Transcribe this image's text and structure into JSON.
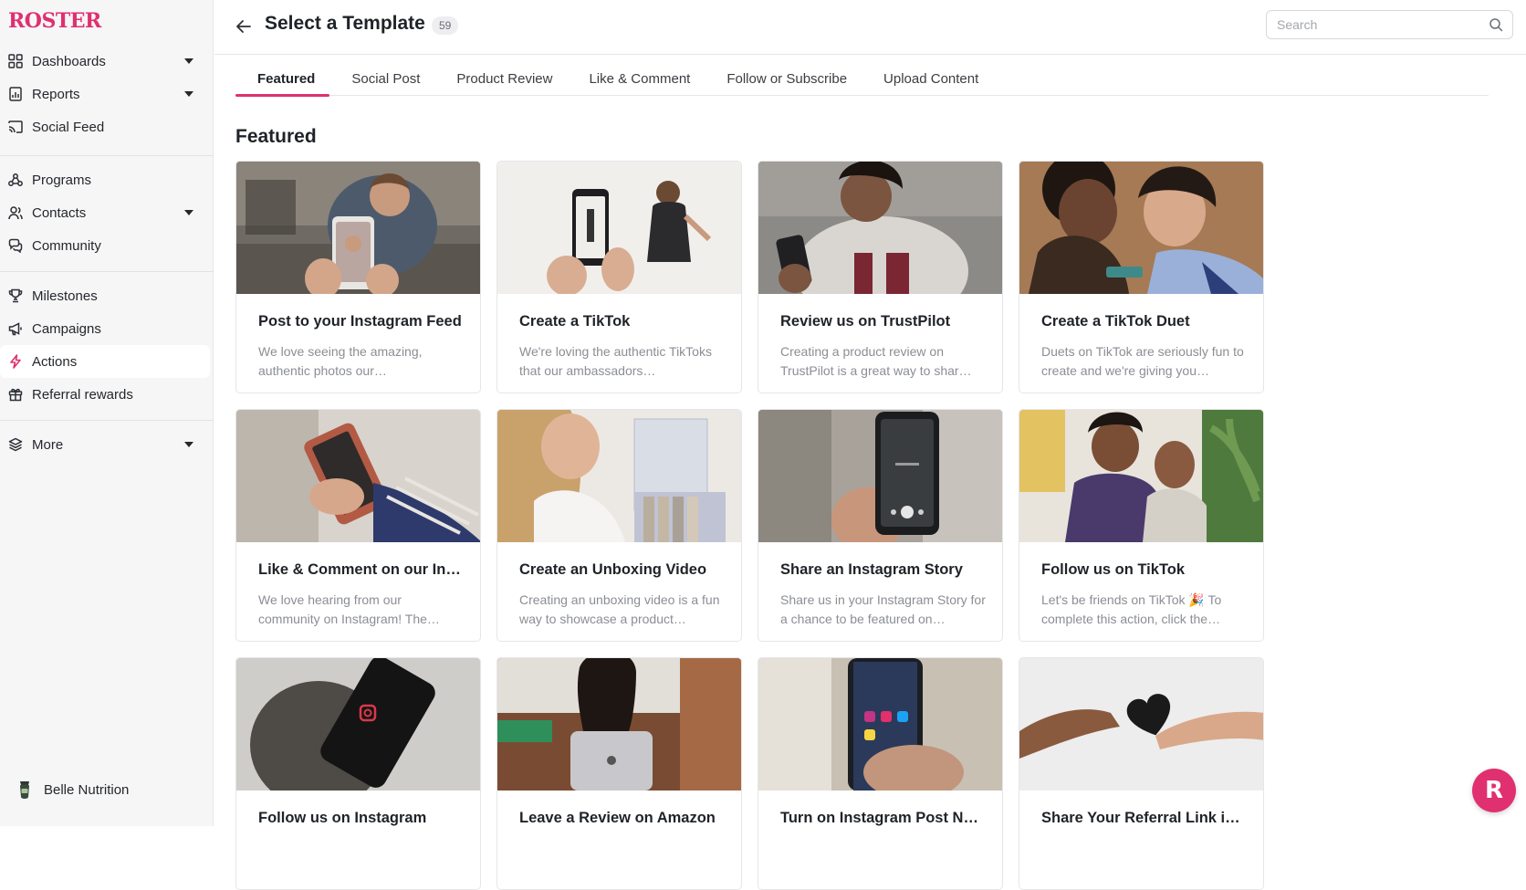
{
  "app": {
    "logo_text": "ROSTER",
    "brand_color": "#e0306f"
  },
  "sidebar": {
    "items": [
      {
        "label": "Dashboards",
        "icon": "grid-icon",
        "has_caret": true
      },
      {
        "label": "Reports",
        "icon": "report-icon",
        "has_caret": true
      },
      {
        "label": "Social Feed",
        "icon": "cast-icon",
        "has_caret": false
      },
      {
        "label": "Programs",
        "icon": "network-icon",
        "has_caret": false
      },
      {
        "label": "Contacts",
        "icon": "contacts-icon",
        "has_caret": true
      },
      {
        "label": "Community",
        "icon": "chat-icon",
        "has_caret": false
      },
      {
        "label": "Milestones",
        "icon": "trophy-icon",
        "has_caret": false
      },
      {
        "label": "Campaigns",
        "icon": "megaphone-icon",
        "has_caret": false
      },
      {
        "label": "Actions",
        "icon": "bolt-icon",
        "has_caret": false,
        "active": true
      },
      {
        "label": "Referral rewards",
        "icon": "gift-icon",
        "has_caret": false
      },
      {
        "label": "More",
        "icon": "layers-icon",
        "has_caret": true
      }
    ],
    "workspace": {
      "name": "Belle Nutrition",
      "icon": "workspace-logo-icon"
    }
  },
  "header": {
    "title": "Select a Template",
    "count": "59",
    "search_placeholder": "Search"
  },
  "tabs": [
    {
      "label": "Featured",
      "active": true
    },
    {
      "label": "Social Post",
      "active": false
    },
    {
      "label": "Product Review",
      "active": false
    },
    {
      "label": "Like & Comment",
      "active": false
    },
    {
      "label": "Follow or Subscribe",
      "active": false
    },
    {
      "label": "Upload Content",
      "active": false
    }
  ],
  "section": {
    "title": "Featured"
  },
  "cards": [
    {
      "title": "Post to your Instagram Feed",
      "desc": "We love seeing the amazing, authentic photos our…",
      "image": "phone-photo-cafe"
    },
    {
      "title": "Create a TikTok",
      "desc": "We're loving the authentic TikToks that our ambassadors…",
      "image": "phone-filming-person"
    },
    {
      "title": "Review us on TrustPilot",
      "desc": "Creating a product review on TrustPilot is a great way to shar…",
      "image": "woman-hoodie-phone"
    },
    {
      "title": "Create a TikTok Duet",
      "desc": "Duets on TikTok are seriously fun to create and we're giving you…",
      "image": "friends-laughing"
    },
    {
      "title": "Like & Comment on our Ins…",
      "desc": "We love hearing from our community on Instagram! The…",
      "image": "hands-phone-sweater"
    },
    {
      "title": "Create an Unboxing Video",
      "desc": "Creating an unboxing video is a fun way to showcase a product…",
      "image": "woman-unboxing"
    },
    {
      "title": "Share an Instagram Story",
      "desc": "Share us in your Instagram Story for a chance to be featured on…",
      "image": "phone-camera-story"
    },
    {
      "title": "Follow us on TikTok",
      "desc": "Let's be friends on TikTok 🎉 To complete this action, click the…",
      "image": "two-men-phone"
    },
    {
      "title": "Follow us on Instagram",
      "desc": "",
      "image": "phone-instagram-logo"
    },
    {
      "title": "Leave a Review on Amazon",
      "desc": "",
      "image": "woman-laptop"
    },
    {
      "title": "Turn on Instagram Post No…",
      "desc": "",
      "image": "phone-social-apps"
    },
    {
      "title": "Share Your Referral Link in …",
      "desc": "",
      "image": "hands-heart"
    }
  ],
  "fab": {
    "label": "R"
  }
}
